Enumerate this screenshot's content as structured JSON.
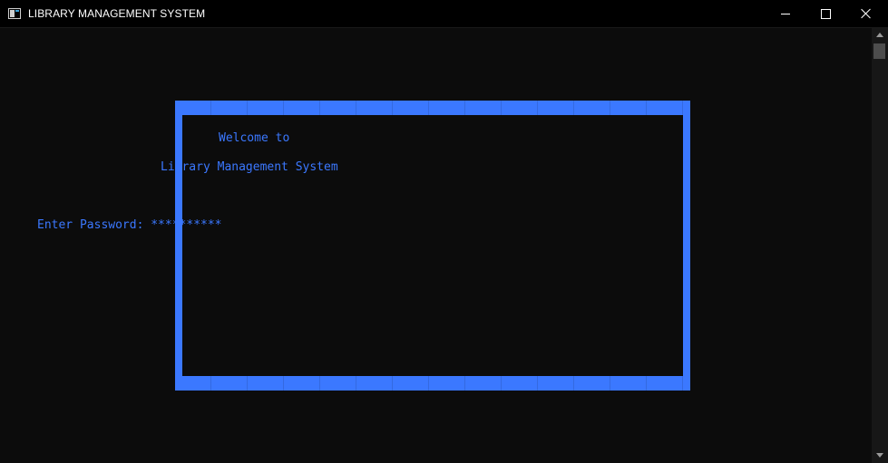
{
  "window": {
    "title": "LIBRARY MANAGEMENT SYSTEM"
  },
  "colors": {
    "console_background": "#0c0c0c",
    "accent": "#3b78ff",
    "titlebar": "#000000"
  },
  "icons": {
    "app": "console-window-icon",
    "minimize": "minimize-icon",
    "maximize": "maximize-icon",
    "close": "close-icon"
  },
  "console": {
    "welcome_line": "Welcome to",
    "system_line": "Library Management System",
    "password_label": "Enter Password: ",
    "password_masked": "**********"
  }
}
